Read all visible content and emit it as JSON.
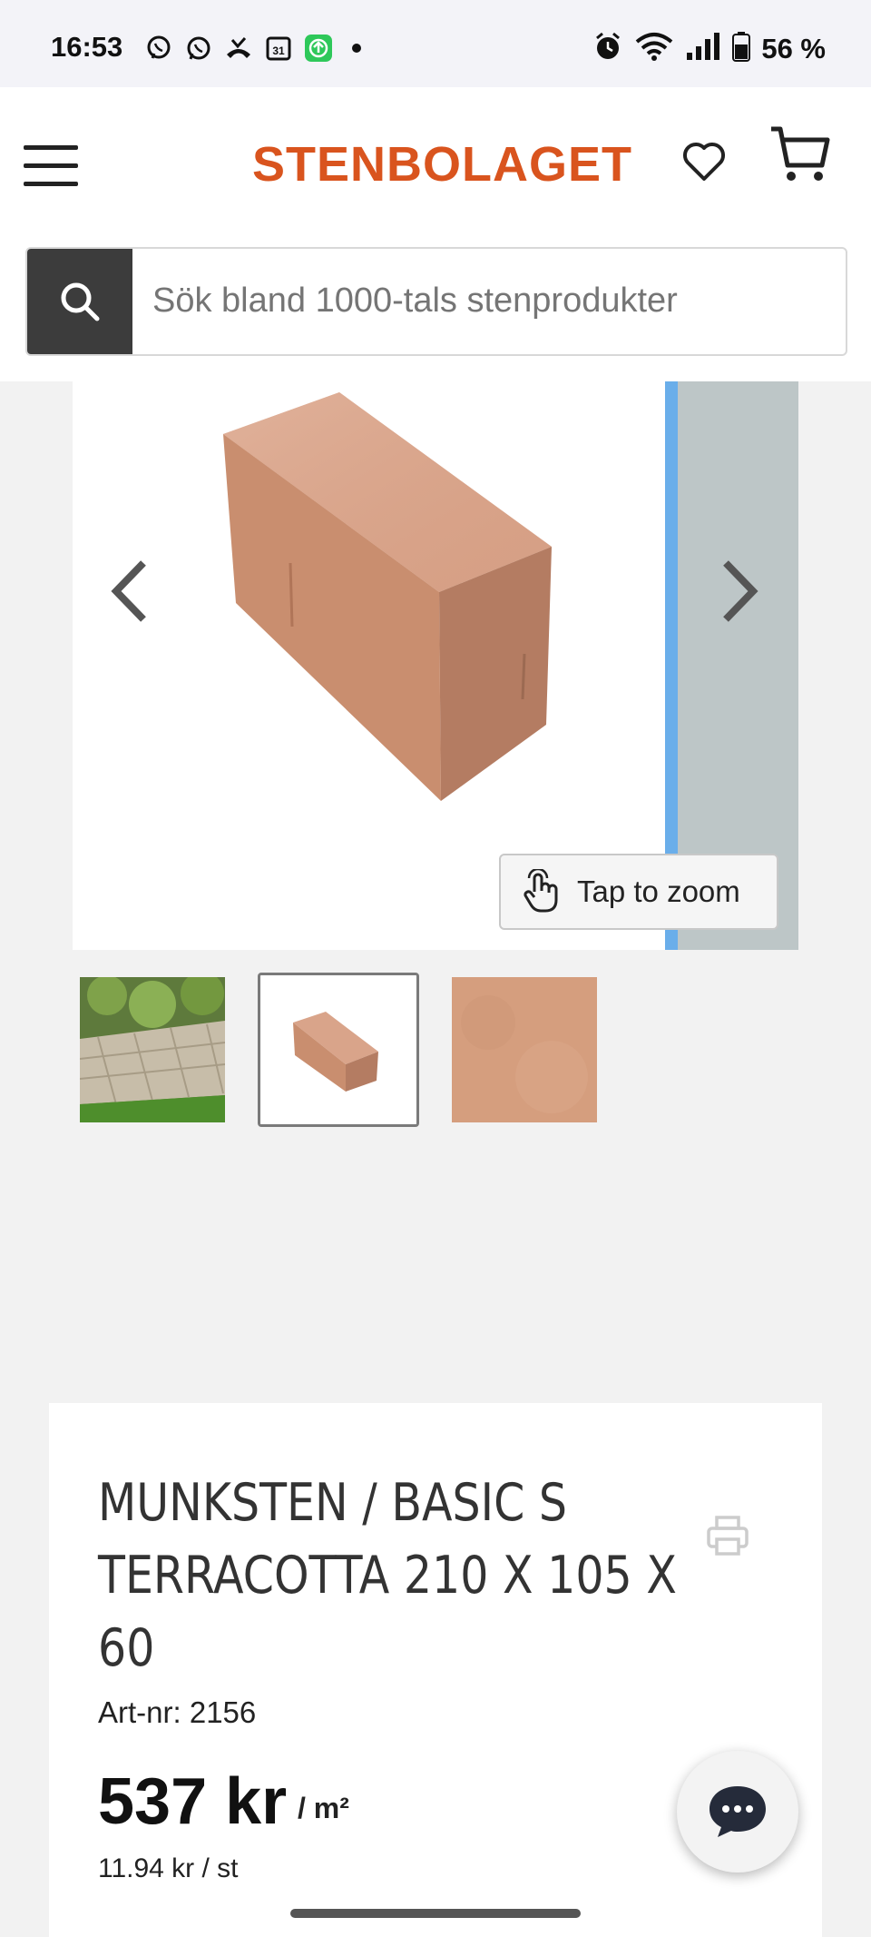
{
  "status_bar": {
    "time": "16:53",
    "battery": "56 %"
  },
  "header": {
    "logo": "STENBOLAGET",
    "search_placeholder": "Sök bland 1000-tals stenprodukter"
  },
  "gallery": {
    "zoom_label": "Tap to zoom",
    "thumbnails": [
      "paved-path",
      "brick",
      "texture"
    ]
  },
  "product": {
    "title": "MUNKSTEN / BASIC S TERRACOTTA 210 X 105 X 60",
    "art_nr": "Art-nr: 2156",
    "price": "537 kr",
    "unit": "/ m²",
    "price_per_piece": "11.94 kr / st"
  },
  "colors": {
    "brand": "#d9541e",
    "search_button": "#3c3c3c",
    "brick": "#d39b7f"
  }
}
